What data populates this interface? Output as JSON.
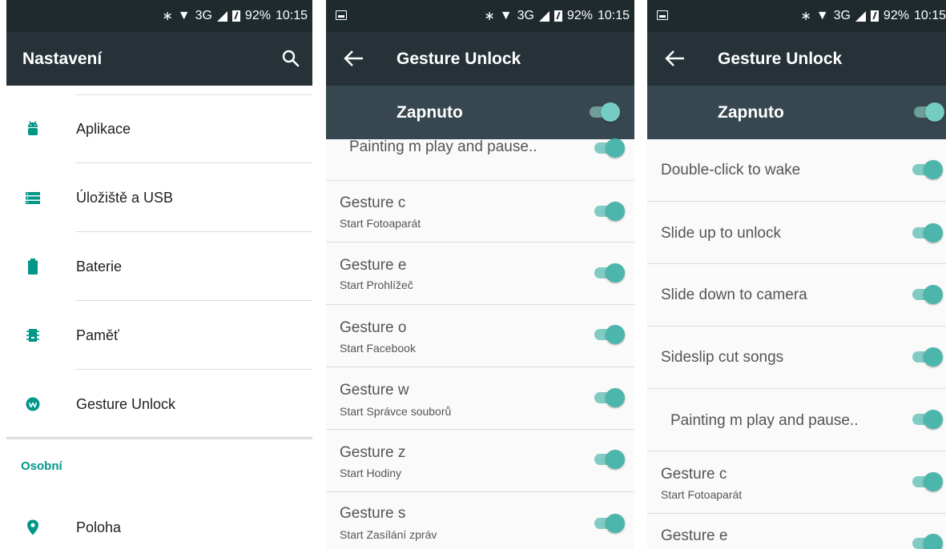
{
  "status_bar": {
    "battery": "92%",
    "time": "10:15",
    "network": "3G"
  },
  "settings": {
    "title": "Nastavení",
    "items": [
      {
        "label": "Aplikace",
        "icon": "android-icon"
      },
      {
        "label": "Úložiště a USB",
        "icon": "storage-icon"
      },
      {
        "label": "Baterie",
        "icon": "battery-icon"
      },
      {
        "label": "Paměť",
        "icon": "memory-icon"
      },
      {
        "label": "Gesture Unlock",
        "icon": "gesture-icon"
      }
    ],
    "category": "Osobní",
    "category_items": [
      {
        "label": "Poloha",
        "icon": "location-icon"
      }
    ]
  },
  "gesture_unlock": {
    "title": "Gesture Unlock",
    "master_label": "Zapnuto",
    "accent_color": "#4db6ac",
    "screen2": {
      "partial": "Painting m play and pause..",
      "gestures": [
        {
          "title": "Gesture c",
          "sub": "Start Fotoaparát"
        },
        {
          "title": "Gesture e",
          "sub": "Start Prohlížeč"
        },
        {
          "title": "Gesture o",
          "sub": "Start Facebook"
        },
        {
          "title": "Gesture w",
          "sub": "Start Správce souborů"
        },
        {
          "title": "Gesture z",
          "sub": "Start Hodiny"
        },
        {
          "title": "Gesture s",
          "sub": "Start Zasílání zpráv"
        }
      ]
    },
    "screen3": {
      "items": [
        "Double-click to wake",
        "Slide up to unlock",
        "Slide down to camera",
        "Sideslip cut songs",
        "Painting m play and pause.."
      ],
      "gestures": [
        {
          "title": "Gesture c",
          "sub": "Start Fotoaparát"
        },
        {
          "title": "Gesture e",
          "sub": ""
        }
      ]
    }
  }
}
